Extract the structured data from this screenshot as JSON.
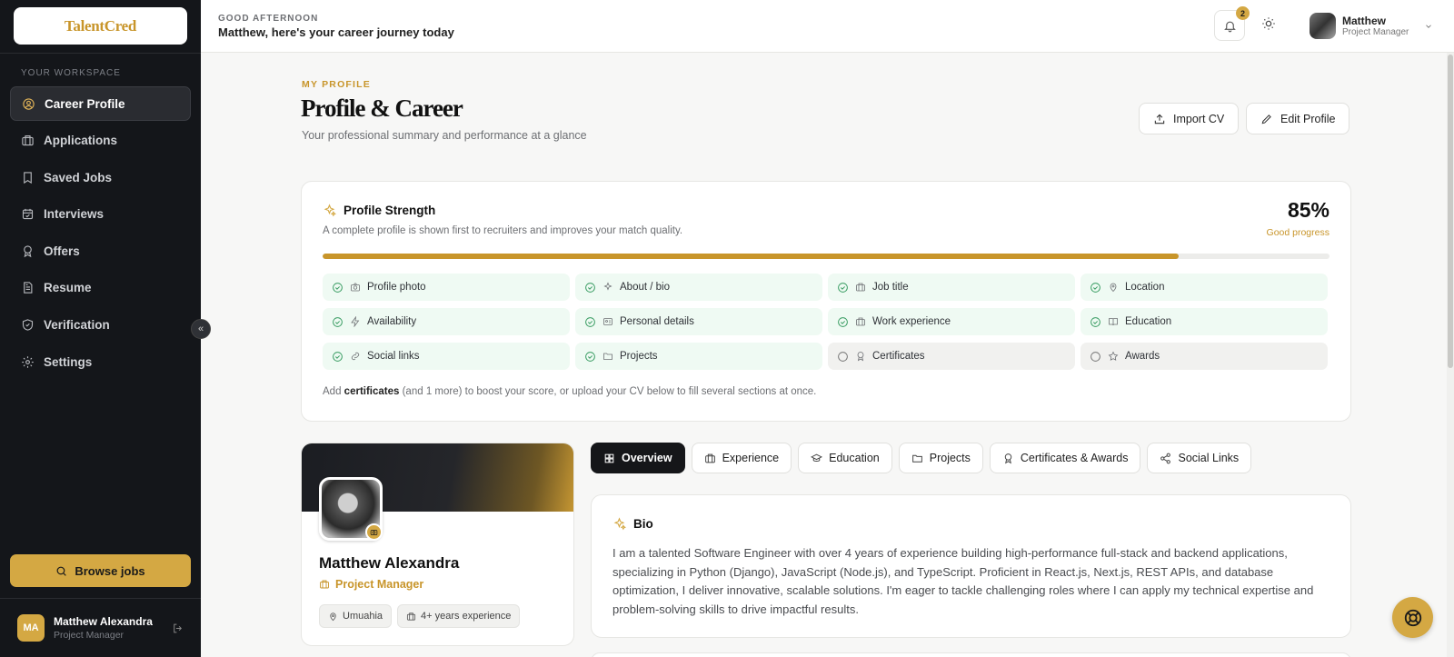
{
  "brand": {
    "logo_text": "TalentCred",
    "accent": "#d4a843"
  },
  "sidebar": {
    "section_label": "YOUR WORKSPACE",
    "items": [
      {
        "label": "Career Profile",
        "icon": "user-circle-icon",
        "active": true
      },
      {
        "label": "Applications",
        "icon": "briefcase-icon"
      },
      {
        "label": "Saved Jobs",
        "icon": "bookmark-icon"
      },
      {
        "label": "Interviews",
        "icon": "calendar-icon"
      },
      {
        "label": "Offers",
        "icon": "award-icon"
      },
      {
        "label": "Resume",
        "icon": "file-text-icon"
      },
      {
        "label": "Verification",
        "icon": "shield-check-icon"
      },
      {
        "label": "Settings",
        "icon": "gear-icon"
      }
    ],
    "browse_label": "Browse jobs",
    "user": {
      "initials": "MA",
      "name": "Matthew Alexandra",
      "role": "Project Manager"
    }
  },
  "header": {
    "greeting_small": "GOOD AFTERNOON",
    "greeting": "Matthew, here's your career journey today",
    "notification_count": "2",
    "user_name": "Matthew",
    "user_role": "Project Manager"
  },
  "page": {
    "eyebrow": "MY PROFILE",
    "title": "Profile & Career",
    "subtitle": "Your professional summary and performance at a glance",
    "import_label": "Import CV",
    "edit_label": "Edit Profile"
  },
  "strength": {
    "title": "Profile Strength",
    "description": "A complete profile is shown first to recruiters and improves your match quality.",
    "percent_text": "85%",
    "percent": 85,
    "progress_label": "Good progress",
    "items": [
      {
        "label": "Profile photo",
        "icon": "camera-icon",
        "done": true
      },
      {
        "label": "About / bio",
        "icon": "sparkles-icon",
        "done": true
      },
      {
        "label": "Job title",
        "icon": "briefcase-icon",
        "done": true
      },
      {
        "label": "Location",
        "icon": "map-pin-icon",
        "done": true
      },
      {
        "label": "Availability",
        "icon": "zap-icon",
        "done": true
      },
      {
        "label": "Personal details",
        "icon": "id-card-icon",
        "done": true
      },
      {
        "label": "Work experience",
        "icon": "briefcase-icon",
        "done": true
      },
      {
        "label": "Education",
        "icon": "book-icon",
        "done": true
      },
      {
        "label": "Social links",
        "icon": "link-icon",
        "done": true
      },
      {
        "label": "Projects",
        "icon": "folder-icon",
        "done": true
      },
      {
        "label": "Certificates",
        "icon": "award-icon",
        "done": false
      },
      {
        "label": "Awards",
        "icon": "star-icon",
        "done": false
      }
    ],
    "hint_prefix": "Add ",
    "hint_bold": "certificates",
    "hint_suffix": " (and 1 more) to boost your score, or upload your CV below to fill several sections at once."
  },
  "profile": {
    "name": "Matthew Alexandra",
    "role": "Project Manager",
    "location": "Umuahia",
    "experience": "4+ years experience"
  },
  "tabs": [
    {
      "label": "Overview",
      "icon": "grid-icon",
      "active": true
    },
    {
      "label": "Experience",
      "icon": "briefcase-icon"
    },
    {
      "label": "Education",
      "icon": "graduation-cap-icon"
    },
    {
      "label": "Projects",
      "icon": "folder-icon"
    },
    {
      "label": "Certificates & Awards",
      "icon": "award-icon"
    },
    {
      "label": "Social Links",
      "icon": "share-icon"
    }
  ],
  "bio": {
    "title": "Bio",
    "text": "I am a talented Software Engineer with over 4 years of experience building high-performance full-stack and backend applications, specializing in Python (Django), JavaScript (Node.js), and TypeScript. Proficient in React.js, Next.js, REST APIs, and database optimization, I deliver innovative, scalable solutions. I'm eager to tackle challenging roles where I can apply my technical expertise and problem-solving skills to drive impactful results."
  }
}
